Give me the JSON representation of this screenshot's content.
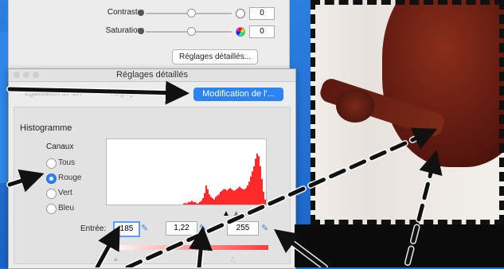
{
  "top_panel": {
    "contrast_label": "Contraste:",
    "contrast_value": "0",
    "saturation_label": "Saturation:",
    "saturation_value": "0",
    "details_button": "Réglages détaillés..."
  },
  "dialog": {
    "title": "Réglages détaillés",
    "tabs": [
      {
        "label": "Égalisation de ton",
        "active": false
      },
      {
        "label": "Réglage des",
        "active": false
      },
      {
        "label": "Modification de l'...",
        "active": true
      }
    ],
    "section_title": "Histogramme",
    "channels_label": "Canaux",
    "channels": [
      {
        "label": "Tous",
        "selected": false
      },
      {
        "label": "Rouge",
        "selected": true
      },
      {
        "label": "Vert",
        "selected": false
      },
      {
        "label": "Bleu",
        "selected": false
      }
    ],
    "input_label": "Entrée:",
    "input_black": "185",
    "input_gamma": "1,22",
    "input_white": "255"
  },
  "histogram": {
    "channel": "Rouge",
    "fill_color": "#ff2b2b",
    "bins": [
      0,
      0,
      0,
      0,
      0,
      0,
      0,
      0,
      0,
      0,
      0,
      0,
      0,
      0,
      0,
      0,
      0,
      0,
      0,
      0,
      0,
      0,
      0,
      0,
      0,
      0,
      0,
      0,
      0,
      0,
      0,
      0,
      0,
      0,
      0,
      0,
      0,
      0,
      0,
      0,
      0,
      0,
      0,
      0,
      0,
      0,
      0,
      0,
      1,
      1,
      1,
      2,
      2,
      3,
      2,
      2,
      1,
      1,
      2,
      3,
      5,
      9,
      15,
      12,
      8,
      6,
      5,
      4,
      6,
      7,
      8,
      10,
      11,
      12,
      12,
      11,
      12,
      13,
      12,
      11,
      11,
      12,
      13,
      14,
      13,
      12,
      12,
      13,
      15,
      18,
      22,
      26,
      30,
      36,
      40,
      38,
      30,
      20,
      10,
      4
    ]
  },
  "colors": {
    "accent": "#2b84f1",
    "arrow": "#111111"
  }
}
